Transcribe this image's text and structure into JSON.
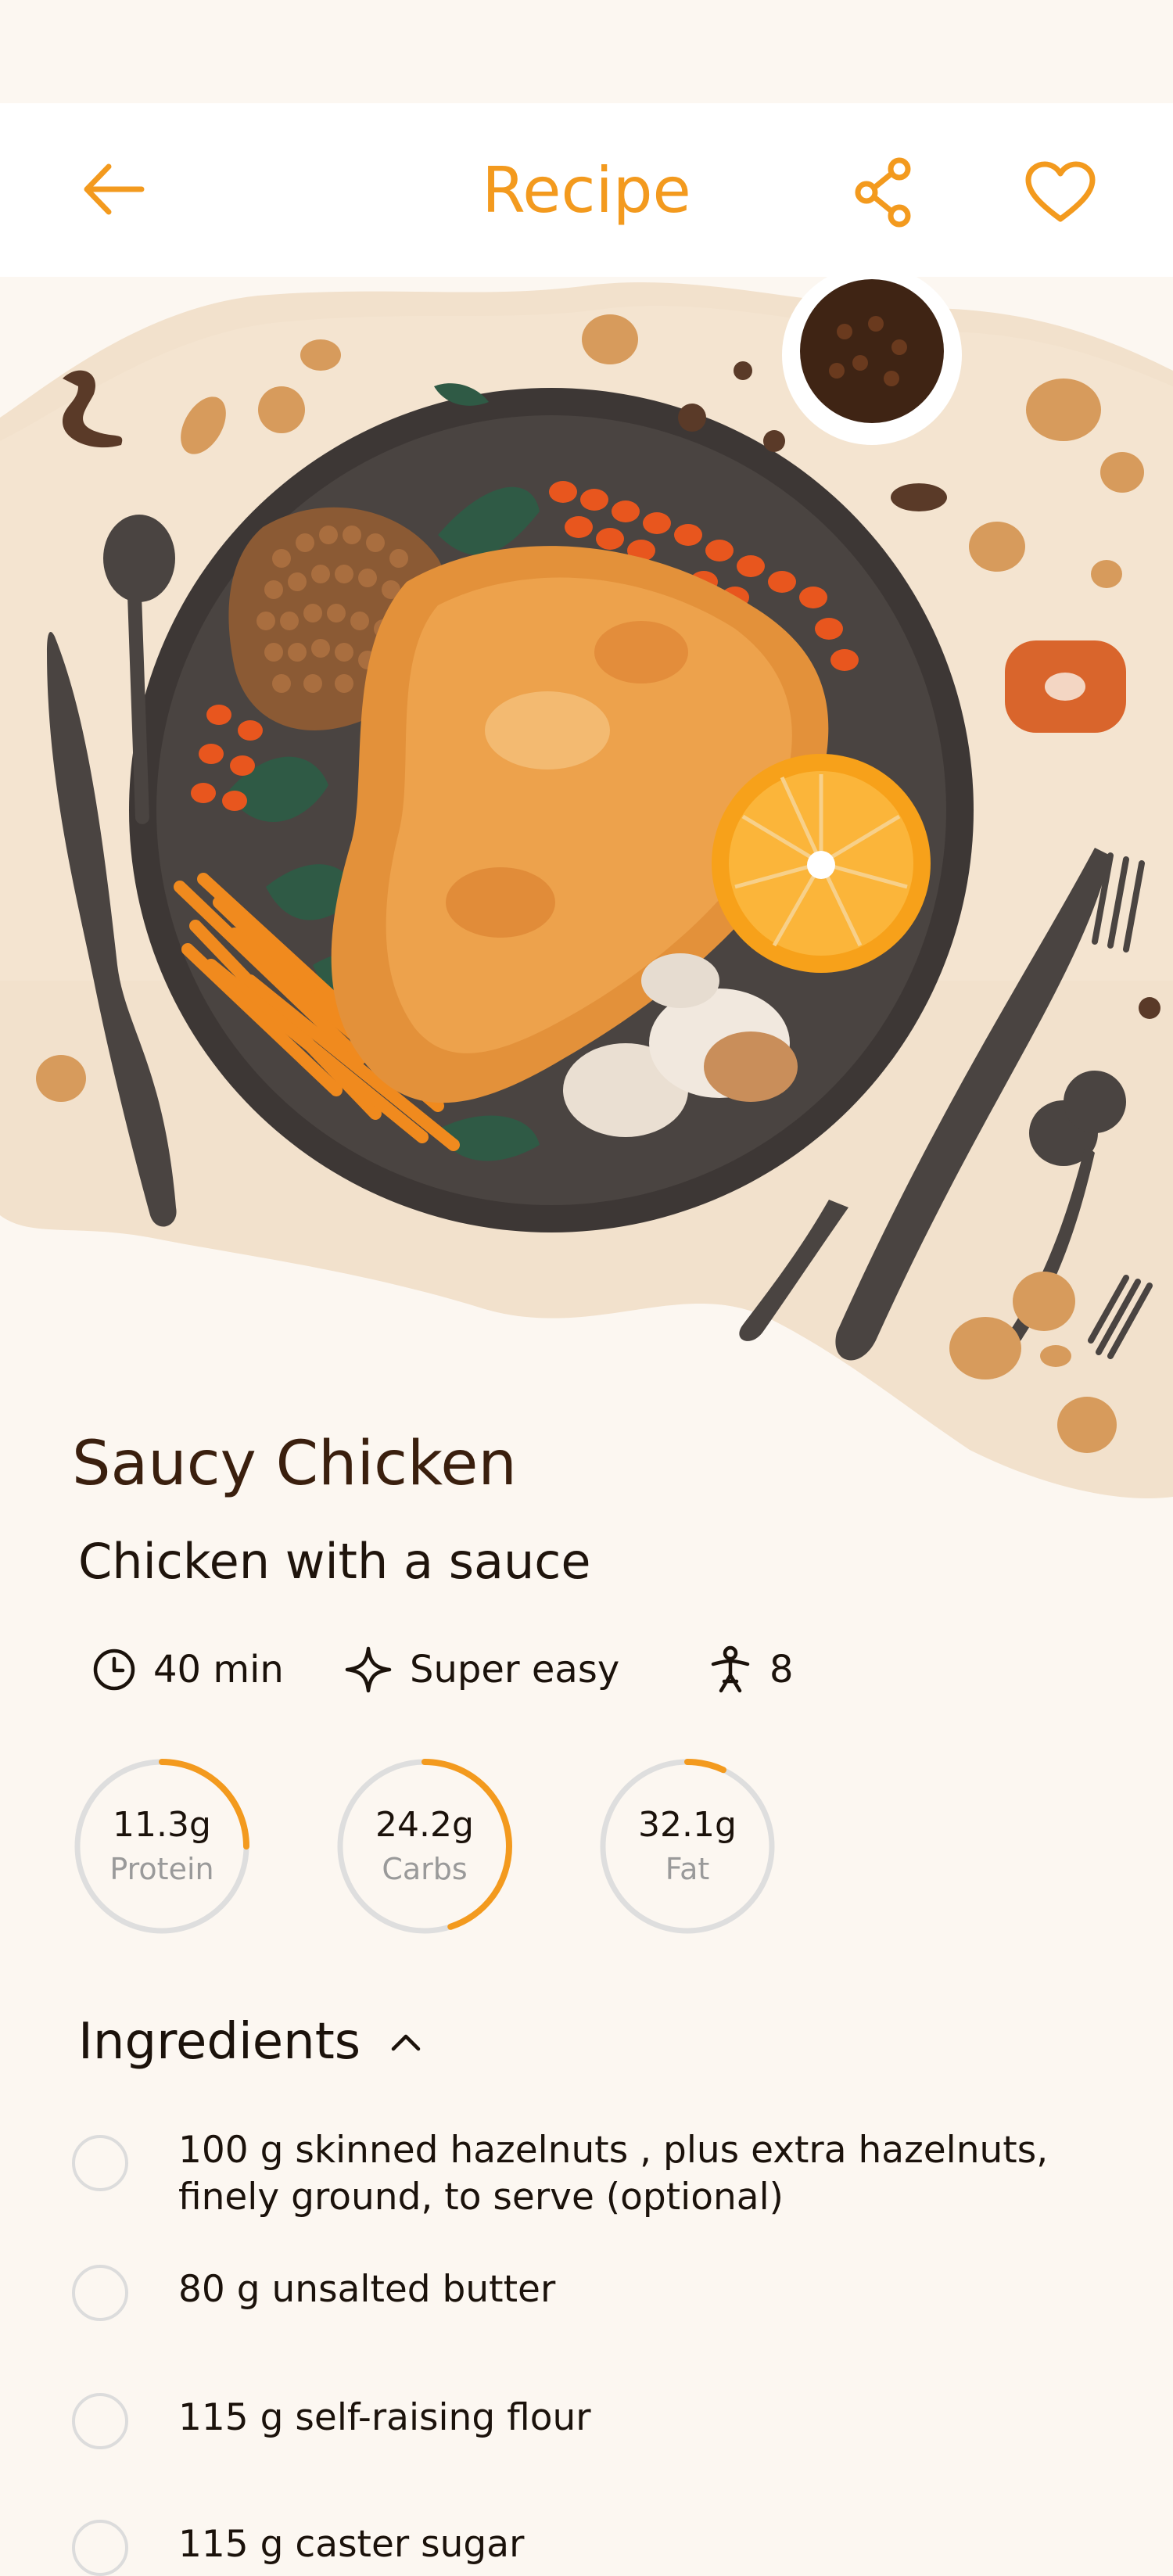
{
  "header": {
    "title": "Recipe",
    "back_icon": "arrow-left-icon",
    "share_icon": "share-icon",
    "favorite_icon": "heart-icon",
    "accent_color": "#F39A1E"
  },
  "recipe": {
    "name": "Saucy Chicken",
    "description": "Chicken with a sauce",
    "time": "40 min",
    "difficulty": "Super easy",
    "servings": "8"
  },
  "nutrition": [
    {
      "value": "11.3g",
      "label": "Protein",
      "progress": 0.25
    },
    {
      "value": "24.2g",
      "label": "Carbs",
      "progress": 0.45
    },
    {
      "value": "32.1g",
      "label": "Fat",
      "progress": 0.07
    }
  ],
  "ingredients": {
    "heading": "Ingredients",
    "items": [
      "100 g skinned hazelnuts , plus extra hazelnuts, finely ground, to serve (optional)",
      "80 g unsalted butter",
      "115 g self-raising flour",
      "115 g caster sugar"
    ]
  }
}
